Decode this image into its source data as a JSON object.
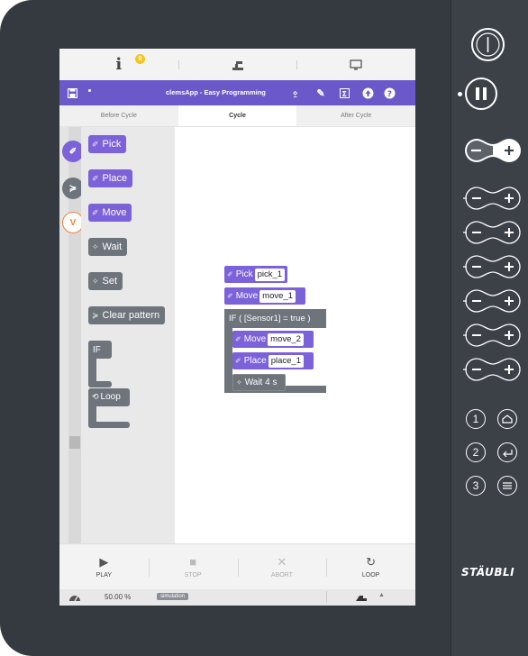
{
  "topbar": {
    "info_icon": "i",
    "notification_count": "0",
    "robot_icon": "robot-arm-icon",
    "monitor_icon": "monitor-icon"
  },
  "titlebar": {
    "title": "clemsApp - Easy Programming",
    "color": "#6c59c9",
    "icons": [
      "save-icon",
      "bug-icon",
      "wand-icon",
      "sum-icon",
      "upload-icon",
      "help-icon"
    ]
  },
  "tabs": [
    {
      "label": "Before Cycle"
    },
    {
      "label": "Cycle"
    },
    {
      "label": "After Cycle"
    }
  ],
  "categories": [
    {
      "name": "motion",
      "color": "#7b62d9"
    },
    {
      "name": "actions",
      "color": "#6e747b"
    },
    {
      "name": "variables",
      "label": "V",
      "color": "#f0803c"
    }
  ],
  "flyout": {
    "pick": "Pick",
    "place": "Place",
    "move": "Move",
    "wait": "Wait",
    "set": "Set",
    "clear_pattern": "Clear pattern",
    "if": "IF",
    "loop": "Loop"
  },
  "program": {
    "pick": {
      "label": "Pick",
      "value": "pick_1"
    },
    "move1": {
      "label": "Move",
      "value": "move_1"
    },
    "if": {
      "label": "IF ( [Sensor1] = true )"
    },
    "move2": {
      "label": "Move",
      "value": "move_2"
    },
    "place": {
      "label": "Place",
      "value": "place_1"
    },
    "wait": {
      "label": "Wait 4 s"
    }
  },
  "controls": [
    {
      "label": "PLAY",
      "glyph": "▶",
      "enabled": true
    },
    {
      "label": "STOP",
      "glyph": "■",
      "enabled": false
    },
    {
      "label": "ABORT",
      "glyph": "✕",
      "enabled": false
    },
    {
      "label": "LOOP",
      "glyph": "↻",
      "enabled": true
    }
  ],
  "status": {
    "speed": "50.00 %",
    "mode": "simulation"
  },
  "hardware": {
    "numbers": [
      "1",
      "2",
      "3"
    ],
    "logo": "STÄUBLI"
  }
}
